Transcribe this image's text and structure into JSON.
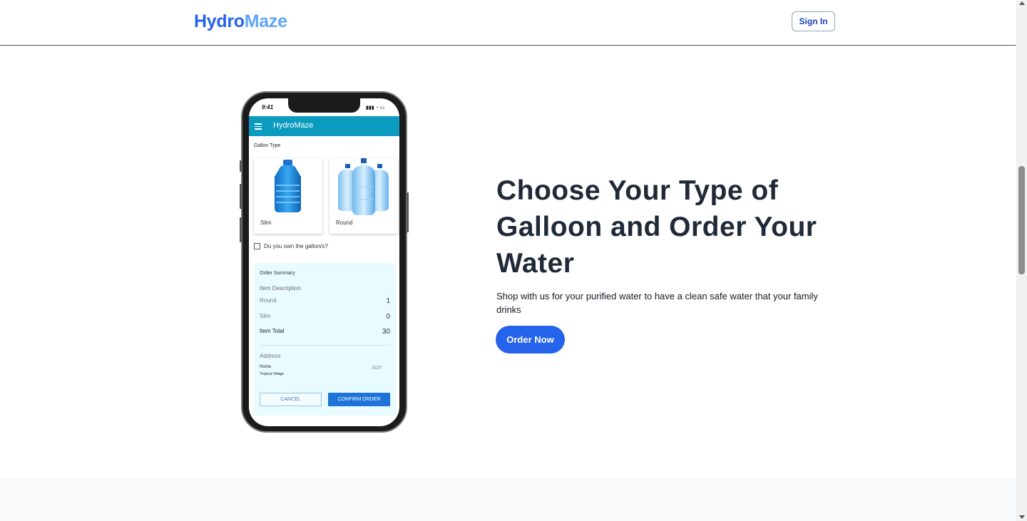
{
  "header": {
    "logo_part1": "Hydro",
    "logo_part2": "Maze",
    "sign_in_label": "Sign In"
  },
  "phone": {
    "time": "9:41",
    "status_icons": "▮▮▮ ◔ ▭",
    "app_title": "HydroMaze",
    "gallon_type_label": "Gallon Type",
    "cards": [
      {
        "label": "Slim"
      },
      {
        "label": "Round"
      }
    ],
    "own_gallon_label": "Do you own the gallon/s?",
    "summary": {
      "title": "Order Summary",
      "item_description": "Item Description",
      "rows": [
        {
          "label": "Round",
          "value": "1"
        },
        {
          "label": "Slim",
          "value": "0"
        },
        {
          "label": "Item Total",
          "value": "30"
        }
      ],
      "address_title": "Address",
      "address_name": "Home",
      "address_detail": "Tropical Village",
      "edit_label": "EDIT",
      "cancel_label": "CANCEL",
      "confirm_label": "CONFIRM ORDER"
    }
  },
  "hero": {
    "title": "Choose Your Type of Galloon and Order Your Water",
    "subtitle": "Shop with us for your purified water to have a clean safe water that your family drinks",
    "cta_label": "Order Now"
  },
  "colors": {
    "brand_blue": "#2563eb",
    "brand_light_blue": "#60a5fa",
    "app_bar": "#0b9bbf",
    "confirm_button": "#1e73d8",
    "heading": "#1f2937"
  }
}
